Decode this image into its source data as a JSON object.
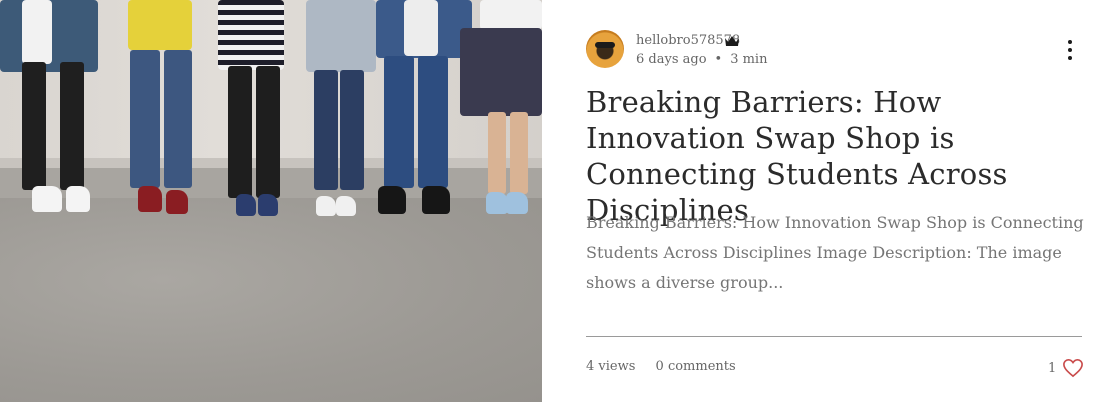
{
  "post": {
    "image": {
      "alt": "Photo of several students standing in a row"
    },
    "author": {
      "name": "hellobro578578",
      "badge_icon": "crown-icon"
    },
    "meta": {
      "date": "6 days ago",
      "separator": "•",
      "read_time": "3 min"
    },
    "more_icon": "more-vertical-icon",
    "title": "Breaking Barriers: How Innovation Swap Shop is Connecting Students Across Disciplines",
    "excerpt": "Breaking Barriers: How Innovation Swap Shop is Connecting Students Across Disciplines Image Description: The image shows a diverse group...",
    "stats": {
      "views": "4 views",
      "comments": "0 comments"
    },
    "likes": {
      "count": "1",
      "icon": "heart-icon",
      "color": "#c94b4b"
    }
  },
  "colors": {
    "title": "#2b2b2b",
    "text": "#757575",
    "divider": "#9a9a9a"
  }
}
